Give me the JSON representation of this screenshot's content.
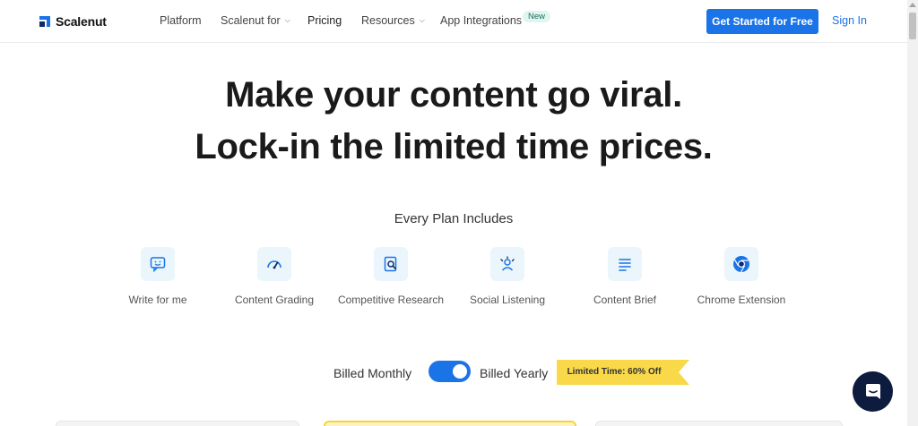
{
  "header": {
    "logo_text": "Scalenut",
    "nav": [
      {
        "label": "Platform"
      },
      {
        "label": "Scalenut for"
      },
      {
        "label": "Pricing"
      },
      {
        "label": "Resources"
      },
      {
        "label": "App Integrations"
      }
    ],
    "new_badge": "New",
    "cta_label": "Get Started for Free",
    "signin_label": "Sign In"
  },
  "hero": {
    "line1": "Make your content go viral.",
    "line2_prefix": "Lock-in the ",
    "line2_highlight": "limited time prices."
  },
  "plan": {
    "heading": "Every Plan Includes",
    "features": [
      {
        "label": "Write for me",
        "icon": "chat-smile-icon"
      },
      {
        "label": "Content Grading",
        "icon": "gauge-icon"
      },
      {
        "label": "Competitive Research",
        "icon": "document-search-icon"
      },
      {
        "label": "Social Listening",
        "icon": "people-icon"
      },
      {
        "label": "Content Brief",
        "icon": "lines-icon"
      },
      {
        "label": "Chrome Extension",
        "icon": "chrome-icon"
      }
    ]
  },
  "billing": {
    "monthly_label": "Billed Monthly",
    "yearly_label": "Billed Yearly",
    "toggle_state": "yearly",
    "promo": "Limited Time: 60% Off"
  },
  "colors": {
    "brand_blue": "#1b73e8",
    "highlight": "#62d6f2",
    "promo_yellow": "#f9d94a",
    "chat_navy": "#0d1b3e"
  }
}
